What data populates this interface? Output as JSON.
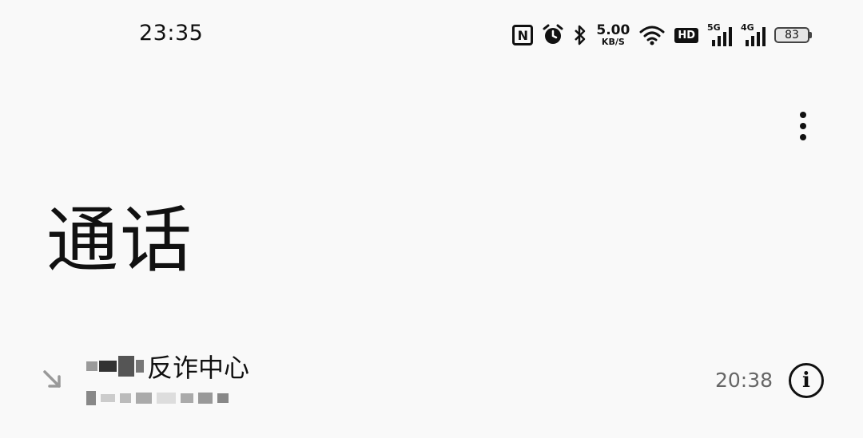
{
  "statusbar": {
    "time": "23:35",
    "icons": [
      "nfc-icon",
      "alarm-icon",
      "bluetooth-icon",
      "wifi-icon",
      "hd-icon",
      "signal-5g-icon",
      "signal-4g-icon",
      "battery-icon"
    ],
    "speed_value": "5.00",
    "speed_unit": "KB/S",
    "hd_label": "HD",
    "sig1_label": "5G",
    "sig2_label": "4G",
    "battery_level": "83"
  },
  "header": {
    "title": "通话"
  },
  "calls": [
    {
      "name_visible": "反诈中心",
      "time": "20:38",
      "direction": "incoming"
    }
  ]
}
